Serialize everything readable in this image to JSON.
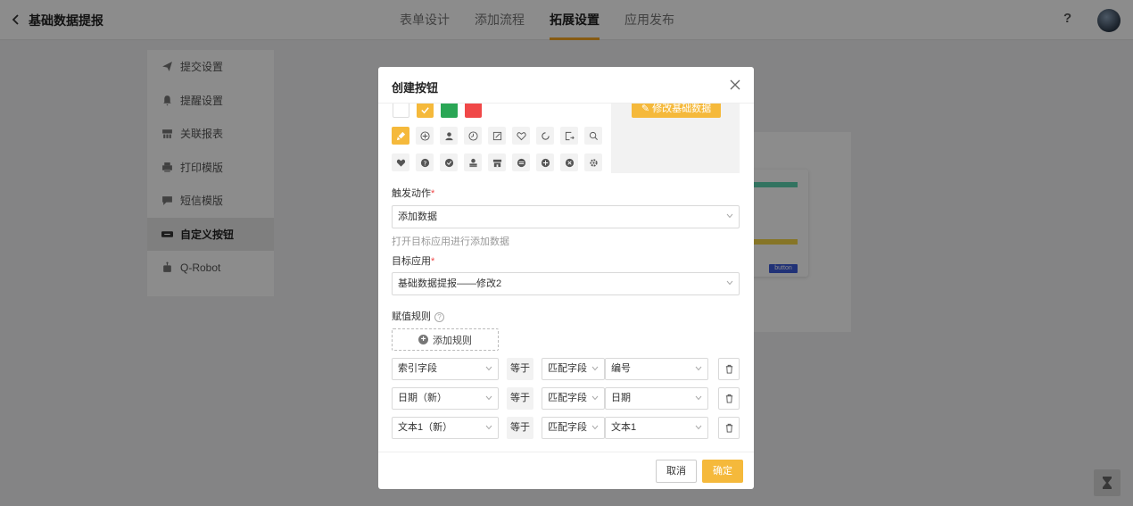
{
  "header": {
    "title": "基础数据提报",
    "tabs": [
      {
        "label": "表单设计"
      },
      {
        "label": "添加流程"
      },
      {
        "label": "拓展设置",
        "active": true
      },
      {
        "label": "应用发布"
      }
    ],
    "help": "?"
  },
  "sidebar": {
    "items": [
      {
        "label": "提交设置",
        "icon": "send-icon"
      },
      {
        "label": "提醒设置",
        "icon": "bell-icon"
      },
      {
        "label": "关联报表",
        "icon": "report-icon"
      },
      {
        "label": "打印模版",
        "icon": "printer-icon"
      },
      {
        "label": "短信模版",
        "icon": "message-icon"
      },
      {
        "label": "自定义按钮",
        "icon": "button-icon",
        "active": true
      },
      {
        "label": "Q-Robot",
        "icon": "robot-icon"
      }
    ]
  },
  "preview_card": {
    "button_label": "button"
  },
  "modal": {
    "title": "创建按钮",
    "colors": [
      "#ffffff",
      "#f5b93b",
      "#2aa655",
      "#f04848"
    ],
    "selected_color": "#f5b93b",
    "icons_row1": [
      "brush-icon",
      "plus-circle-icon",
      "user-icon",
      "clock-icon",
      "edit-icon",
      "heart-outline-icon",
      "refresh-icon",
      "export-icon",
      "search-icon"
    ],
    "icons_row2": [
      "heart-icon",
      "question-icon",
      "check-circle-icon",
      "stamp-icon",
      "shop-icon",
      "minus-circle-icon",
      "plus-solid-icon",
      "close-circle-icon",
      "gear-icon"
    ],
    "preview_button_label": "修改基础数据",
    "trigger": {
      "label": "触发动作",
      "required": "*",
      "value": "添加数据",
      "hint": "打开目标应用进行添加数据"
    },
    "target": {
      "label": "目标应用",
      "required": "*",
      "value": "基础数据提报——修改2"
    },
    "rules": {
      "label": "赋值规则",
      "help": "?",
      "add_label": "添加规则",
      "rows": [
        {
          "index_field": "索引字段",
          "op": "等于",
          "match": "匹配字段",
          "target": "编号"
        },
        {
          "index_field": "日期（新）",
          "op": "等于",
          "match": "匹配字段",
          "target": "日期"
        },
        {
          "index_field": "文本1（新）",
          "op": "等于",
          "match": "匹配字段",
          "target": "文本1"
        }
      ]
    },
    "cancel_label": "取消",
    "ok_label": "确定"
  }
}
